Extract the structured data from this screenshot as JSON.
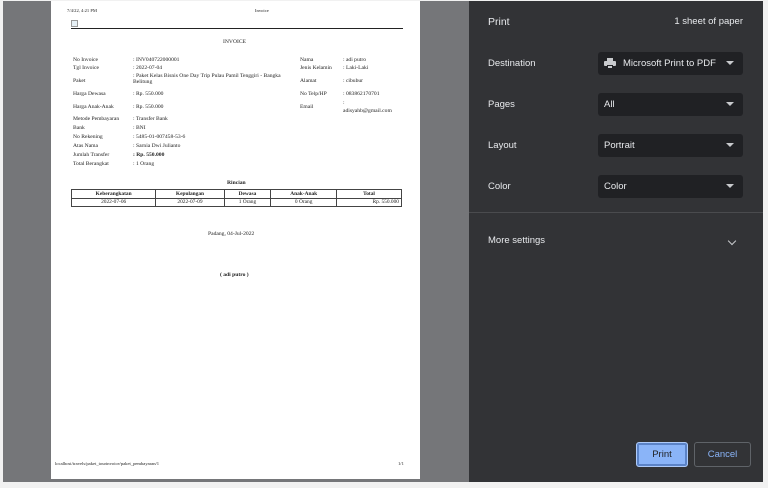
{
  "paper": {
    "header_left": "7/4/22, 4:21 PM",
    "header_center": "Invoice",
    "invoice_title": "INVOICE",
    "left_fields": [
      {
        "label": "No Invoice",
        "value": ": INV040722000001"
      },
      {
        "label": "Tgl Invoice",
        "value": ": 2022-07-04"
      },
      {
        "label": "Paket",
        "value": ": Paket Kelas Bisnis One Day Trip Pulau Pamil Tenggiri - Bangka Belitung"
      },
      {
        "label": "Harga Dewasa",
        "value": ": Rp. 550.000"
      },
      {
        "label": "Harga Anak-Anak",
        "value": ": Rp. 550.000"
      },
      {
        "label": "Metode Pembayaran",
        "value": ": Transfer Bank"
      },
      {
        "label": "Bank",
        "value": ": BNI"
      },
      {
        "label": "No Rekening",
        "value": ": 5485-01-007458-53-6"
      },
      {
        "label": "Atas Nama",
        "value": ": Sarnia Dwi Julianto"
      },
      {
        "label": "Jumlah Transfer",
        "value": ": Rp. 550.000"
      },
      {
        "label": "Total Berangkat",
        "value": ": 1 Orang"
      }
    ],
    "right_fields": [
      {
        "label": "Nama",
        "value": ": adi putro"
      },
      {
        "label": "Jenis Kelamin",
        "value": ": Laki-Laki"
      },
      {
        "label": "Alamat",
        "value": ": cibubur"
      },
      {
        "label": "No Telp/HP",
        "value": ": 083862170701"
      },
      {
        "label": "Email",
        "value": ":"
      },
      {
        "label": "",
        "value": "adisyahb@gmail.com"
      }
    ],
    "rincian_title": "Rincian",
    "table_headers": [
      "Keberangkatan",
      "Kepulangan",
      "Dewasa",
      "Anak-Anak",
      "Total"
    ],
    "table_row": [
      "2022-07-06",
      "2022-07-09",
      "1 Orang",
      "0 Orang",
      "Rp. 550.000"
    ],
    "place_date": "Padang, 04-Jul-2022",
    "signature": "( adi putro )",
    "footer_left": "localhost/travels/paket_tourinvoice/paket_pembayaran/1",
    "footer_right": "1/1"
  },
  "panel": {
    "title": "Print",
    "sheet_count": "1 sheet of paper",
    "destination_label": "Destination",
    "destination_value": "Microsoft Print to PDF",
    "pages_label": "Pages",
    "pages_value": "All",
    "layout_label": "Layout",
    "layout_value": "Portrait",
    "color_label": "Color",
    "color_value": "Color",
    "more_settings": "More settings",
    "print_button": "Print",
    "cancel_button": "Cancel"
  }
}
